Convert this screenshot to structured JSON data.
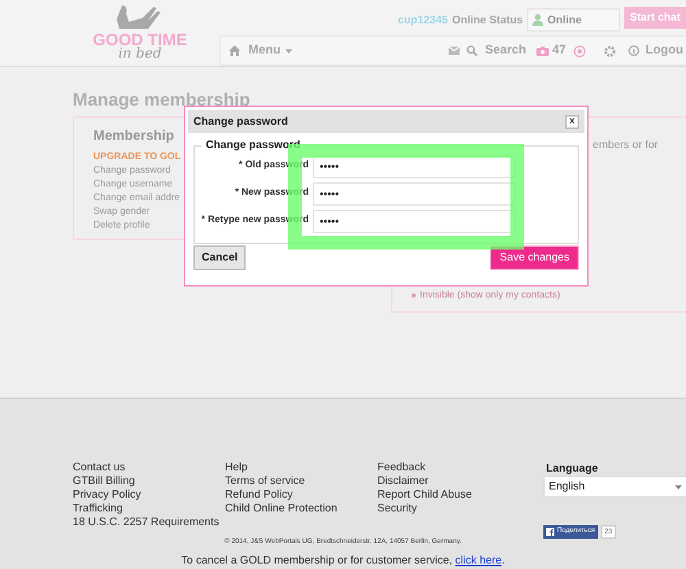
{
  "header": {
    "logo": {
      "line_1": "GOOD TIME",
      "line_2": "in bed"
    },
    "username": "cup12345",
    "status_label": "Online Status",
    "status_select": "Online",
    "start_chat": "Start chat"
  },
  "nav": {
    "menu": "Menu",
    "search": "Search",
    "photo_count": "47",
    "logout": "Logou"
  },
  "page": {
    "title": "Manage membership",
    "membership": {
      "heading": "Membership",
      "items": [
        {
          "label": "UPGRADE TO GOL",
          "kind": "highlight"
        },
        {
          "label": "Change password",
          "kind": "link"
        },
        {
          "label": "Change username",
          "kind": "link"
        },
        {
          "label": "Change email addre",
          "kind": "link"
        },
        {
          "label": "Swap gender",
          "kind": "link"
        },
        {
          "label": "Delete profile",
          "kind": "link"
        }
      ]
    },
    "right_panel": {
      "text": "embers or for",
      "option": "Invisible (show only my contacts)"
    }
  },
  "dialog": {
    "title": "Change password",
    "close": "x",
    "fieldset_legend": "Change password",
    "fields": [
      {
        "label": "* Old password",
        "value": "•••••"
      },
      {
        "label": "* New password",
        "value": "•••••"
      },
      {
        "label": "* Retype new password",
        "value": "•••••"
      }
    ],
    "cancel": "Cancel",
    "save": "Save changes"
  },
  "footer": {
    "columns": [
      [
        "Contact us",
        "GTBill Billing",
        "Privacy Policy",
        "Trafficking",
        "18 U.S.C. 2257 Requirements"
      ],
      [
        "Help",
        "Terms of service",
        "Refund Policy",
        "Child Online Protection"
      ],
      [
        "Feedback",
        "Disclaimer",
        "Report Child Abuse",
        "Security"
      ]
    ],
    "language_label": "Language",
    "language_select": "English",
    "share": "Поделиться",
    "share_count": "23",
    "copyright": "© 2014, J&S WebPortals UG, Bredtschneiderstr. 12A, 14057 Berlin, Germany.",
    "cancel_text": "To cancel a GOLD membership or for customer service, ",
    "cancel_link": "click here",
    "cancel_end": "."
  }
}
